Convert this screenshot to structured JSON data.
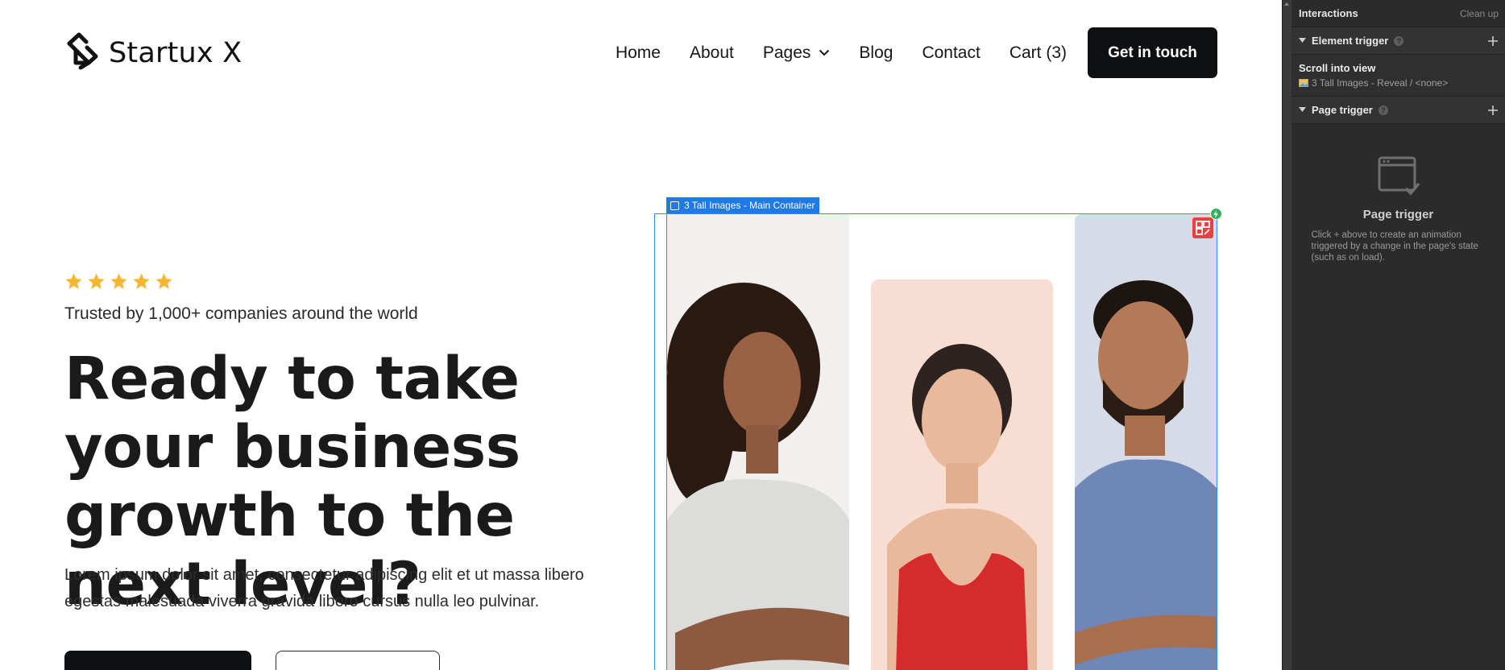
{
  "site": {
    "logo_text": "Startux X",
    "nav": [
      "Home",
      "About",
      "Pages",
      "Blog",
      "Contact",
      "Cart (3)"
    ],
    "cta_label": "Get in touch"
  },
  "hero": {
    "rating_stars": 5,
    "trusted": "Trusted by 1,000+ companies around the world",
    "headline": "Ready to take your business growth to the next level?",
    "lede": "Lorem ipsum dolor sit amet, consectetur adipiscing elit et ut massa libero egestas malesuada viverra gravida libero cursus nulla leo pulvinar."
  },
  "selection": {
    "tag": "3 Tall Images - Main Container"
  },
  "panel": {
    "title": "Interactions",
    "cleanup": "Clean up",
    "element_trigger": "Element trigger",
    "trigger_name": "Scroll into view",
    "trigger_target": "3 Tall Images - Reveal / <none>",
    "page_trigger": "Page trigger",
    "empty_title": "Page trigger",
    "empty_desc": "Click + above to create an animation triggered by a change in the page's state (such as on load)."
  },
  "icons": [
    "logo-mark-icon",
    "chevron-down-icon",
    "star-icon",
    "container-icon",
    "interaction-badge-icon",
    "lightning-icon",
    "triangle-down-icon",
    "help-icon",
    "plus-icon",
    "image-icon",
    "page-window-icon"
  ],
  "colors": {
    "accent": "#1f7ae8",
    "star": "#f5b731",
    "panel_bg": "#2b2b2b",
    "cta_bg": "#0f1012"
  }
}
